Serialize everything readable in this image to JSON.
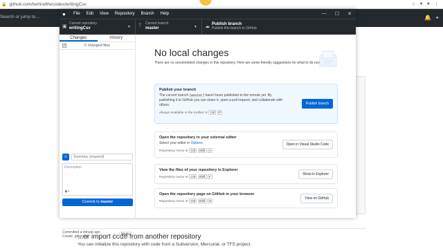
{
  "browser": {
    "url": "github.com/behindthecodex/writingCsv"
  },
  "gh": {
    "search_placeholder": "Search or jump to..."
  },
  "app": {
    "menu": [
      "File",
      "Edit",
      "View",
      "Repository",
      "Branch",
      "Help"
    ],
    "toolbar": {
      "repo_label": "Current repository",
      "repo_value": "writingCsv",
      "branch_label": "Current branch",
      "branch_value": "master",
      "publish_label": "Publish branch",
      "publish_desc": "Publish this branch to GitHub"
    },
    "sidebar": {
      "tab_changes": "Changes",
      "tab_history": "History",
      "changed_files": "0 changed files",
      "summary_placeholder": "Summary (required)",
      "description_placeholder": "Description",
      "commit_prefix": "Commit to ",
      "commit_branch": "master",
      "last_commit_time": "Committed a minute ago",
      "last_commit_msg": "Create .gitignore",
      "undo": "Undo"
    },
    "main": {
      "title": "No local changes",
      "subtitle": "There are no uncommitted changes in this repository. Here are some friendly suggestions for what to do next.",
      "publish": {
        "title": "Publish your branch",
        "desc_1": "The current branch (",
        "branch_code": "master",
        "desc_2": ") hasn't been published to the remote yet. By publishing it to GitHub you can share it, open a pull request, and collaborate with others.",
        "hint": "Always available in the toolbar or",
        "keys": [
          "Ctrl",
          "P"
        ],
        "button": "Publish branch"
      },
      "editor": {
        "title": "Open the repository in your external editor",
        "desc": "Select your editor in ",
        "desc_link": "Options",
        "hint": "Repository menu or",
        "keys": [
          "Ctrl",
          "Shift",
          "A"
        ],
        "button": "Open in Visual Studio Code"
      },
      "explorer": {
        "title": "View the files of your repository in Explorer",
        "hint": "Repository menu or",
        "keys": [
          "Ctrl",
          "Shift",
          "F"
        ],
        "button": "Show in Explorer"
      },
      "github": {
        "title": "Open the repository page on GitHub in your browser",
        "hint": "Repository menu or",
        "keys": [
          "Ctrl",
          "Shift",
          "G"
        ],
        "button": "View on GitHub"
      }
    }
  },
  "background": {
    "import_title": "...or import code from another repository",
    "import_desc": "You can initialize this repository with code from a Subversion, Mercurial, or TFS project."
  }
}
